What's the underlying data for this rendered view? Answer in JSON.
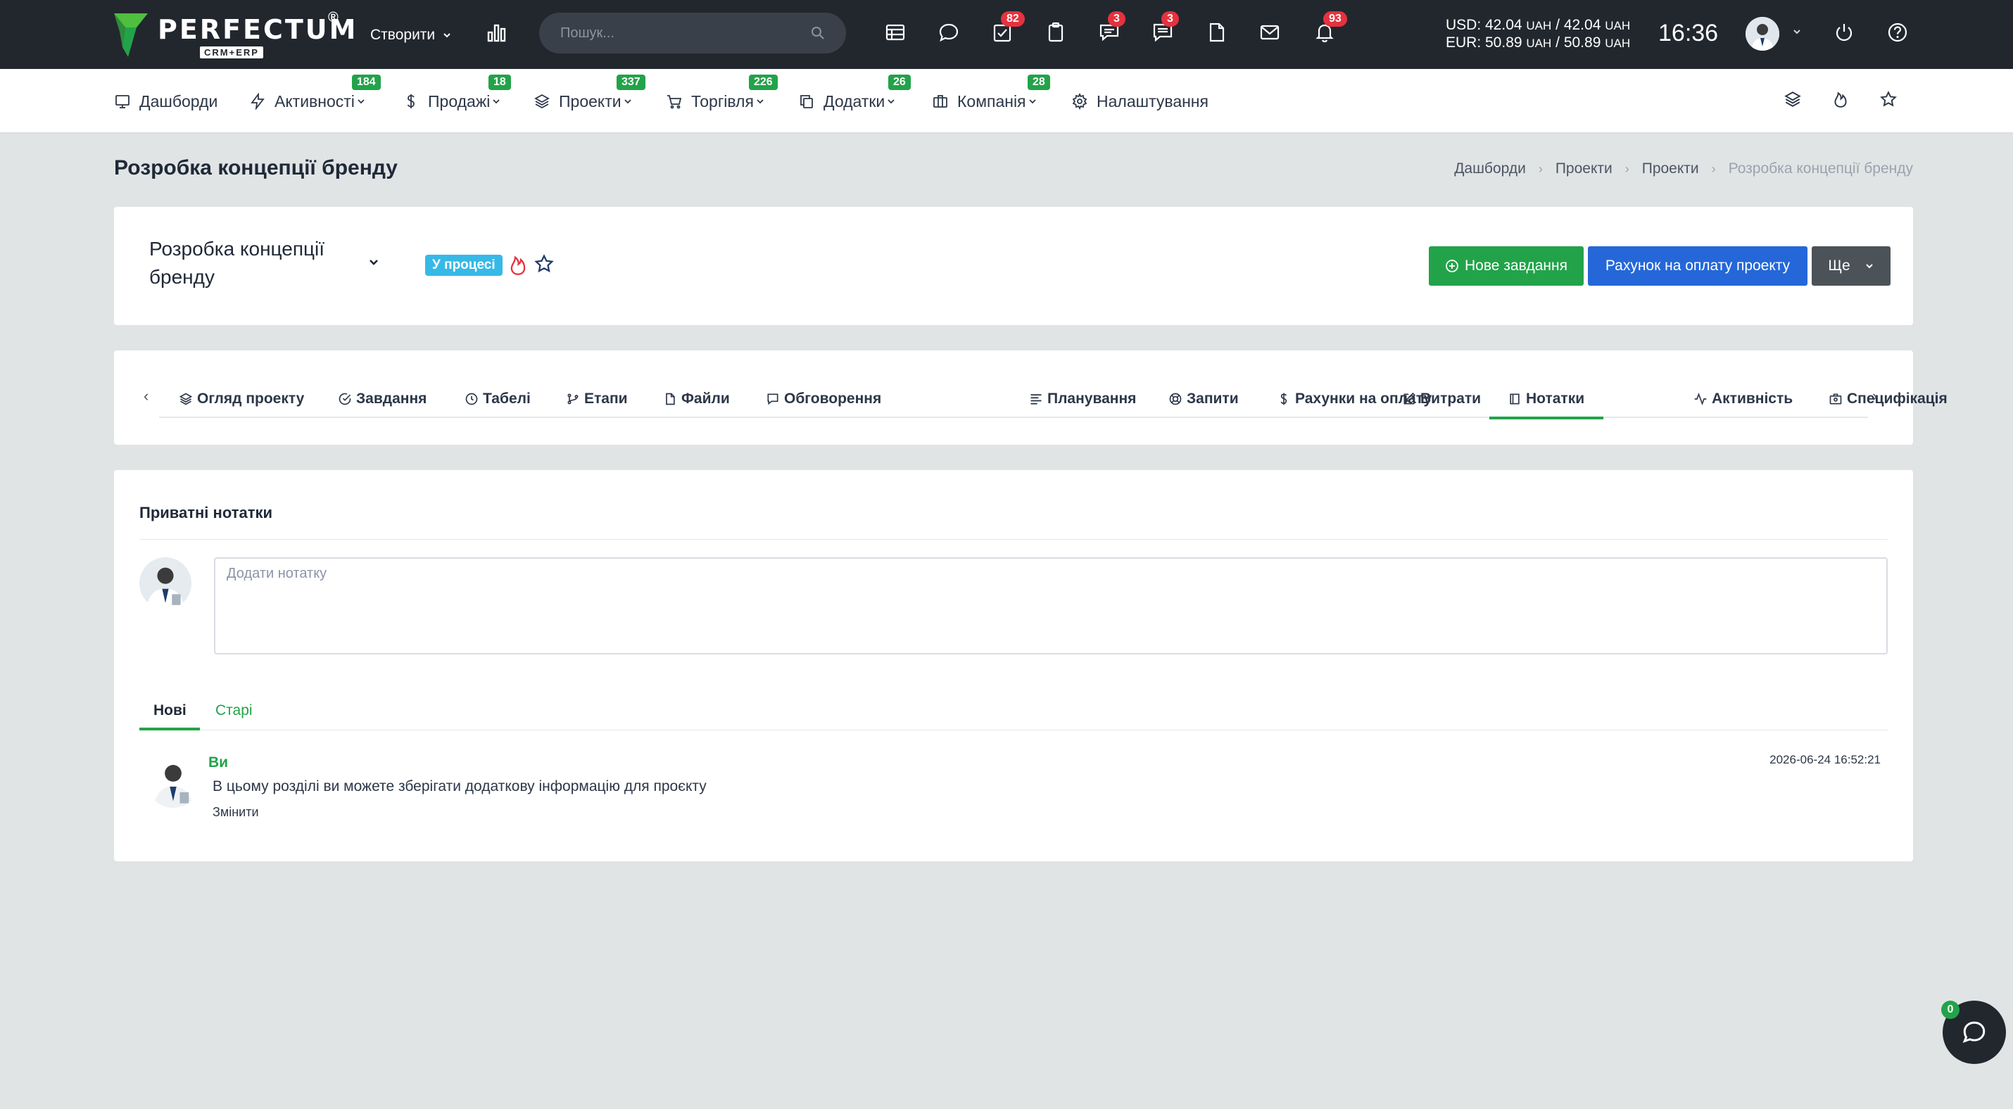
{
  "brand": {
    "name": "PERFECTUM",
    "registered": "®",
    "subtitle": "CRM+ERP",
    "colors": {
      "green": "#22a34a",
      "dark": "#22272e",
      "blue": "#2567d8",
      "red": "#e5323e"
    }
  },
  "topbar": {
    "create_label": "Створити",
    "search_placeholder": "Пошук...",
    "icons": [
      {
        "name": "calendar-icon",
        "badge": ""
      },
      {
        "name": "chat-bubble-icon",
        "badge": ""
      },
      {
        "name": "tasks-check-icon",
        "badge": "82"
      },
      {
        "name": "clipboard-icon",
        "badge": ""
      },
      {
        "name": "messages-icon",
        "badge": "3"
      },
      {
        "name": "comments-icon",
        "badge": "3"
      },
      {
        "name": "document-icon",
        "badge": ""
      },
      {
        "name": "mail-icon",
        "badge": ""
      },
      {
        "name": "bell-icon",
        "badge": "93"
      }
    ],
    "currency_usd": "USD: 42.04",
    "currency_usd_unit": "UAH",
    "currency_usd_sep": "/ 42.04",
    "currency_eur": "EUR: 50.89",
    "currency_eur_unit": "UAH",
    "currency_eur_sep": "/ 50.89",
    "clock": "16:36"
  },
  "nav": {
    "items": [
      {
        "label": "Дашборди",
        "badge": "",
        "icon": "monitor-icon"
      },
      {
        "label": "Активності",
        "badge": "184",
        "icon": "lightning-icon"
      },
      {
        "label": "Продажі",
        "badge": "18",
        "icon": "dollar-icon"
      },
      {
        "label": "Проекти",
        "badge": "337",
        "icon": "layers-icon"
      },
      {
        "label": "Торгівля",
        "badge": "226",
        "icon": "cart-icon"
      },
      {
        "label": "Додатки",
        "badge": "26",
        "icon": "copy-icon"
      },
      {
        "label": "Компанія",
        "badge": "28",
        "icon": "briefcase-icon"
      },
      {
        "label": "Налаштування",
        "badge": "",
        "icon": "gear-icon"
      }
    ]
  },
  "page": {
    "title": "Розробка концепції бренду",
    "breadcrumb": [
      "Дашборди",
      "Проекти",
      "Проекти",
      "Розробка концепції бренду"
    ]
  },
  "project": {
    "name": "Розробка концепції бренду",
    "status": "У процесі",
    "new_task_button": "Нове завдання",
    "invoice_button": "Рахунок на оплату проекту",
    "more_button": "Ще"
  },
  "tabs": [
    {
      "label": "Огляд проекту",
      "icon": "layers-icon"
    },
    {
      "label": "Завдання",
      "icon": "check-circle-icon"
    },
    {
      "label": "Табелі",
      "icon": "clock-icon"
    },
    {
      "label": "Етапи",
      "icon": "git-branch-icon"
    },
    {
      "label": "Файли",
      "icon": "file-icon"
    },
    {
      "label": "Обговорення",
      "icon": "chat-icon"
    },
    {
      "label": "Планування",
      "icon": "gantt-icon"
    },
    {
      "label": "Запити",
      "icon": "lifebuoy-icon"
    },
    {
      "label": "Рахунки на оплату",
      "icon": "dollar-icon"
    },
    {
      "label": "Витрати",
      "icon": "edit-icon"
    },
    {
      "label": "Нотатки",
      "icon": "book-icon",
      "active": true
    },
    {
      "label": "Активність",
      "icon": "activity-icon"
    },
    {
      "label": "Специфікація",
      "icon": "spec-icon"
    }
  ],
  "notes": {
    "title": "Приватні нотатки",
    "placeholder": "Додати нотатку",
    "sort_new": "Нові",
    "sort_old": "Старі",
    "items": [
      {
        "author": "Ви",
        "text": "В цьому розділі ви можете зберігати додаткову інформацію для проєкту",
        "edit_label": "Змінити",
        "date": "2026-06-24 16:52:21"
      }
    ]
  },
  "chat_widget": {
    "badge": "0"
  }
}
